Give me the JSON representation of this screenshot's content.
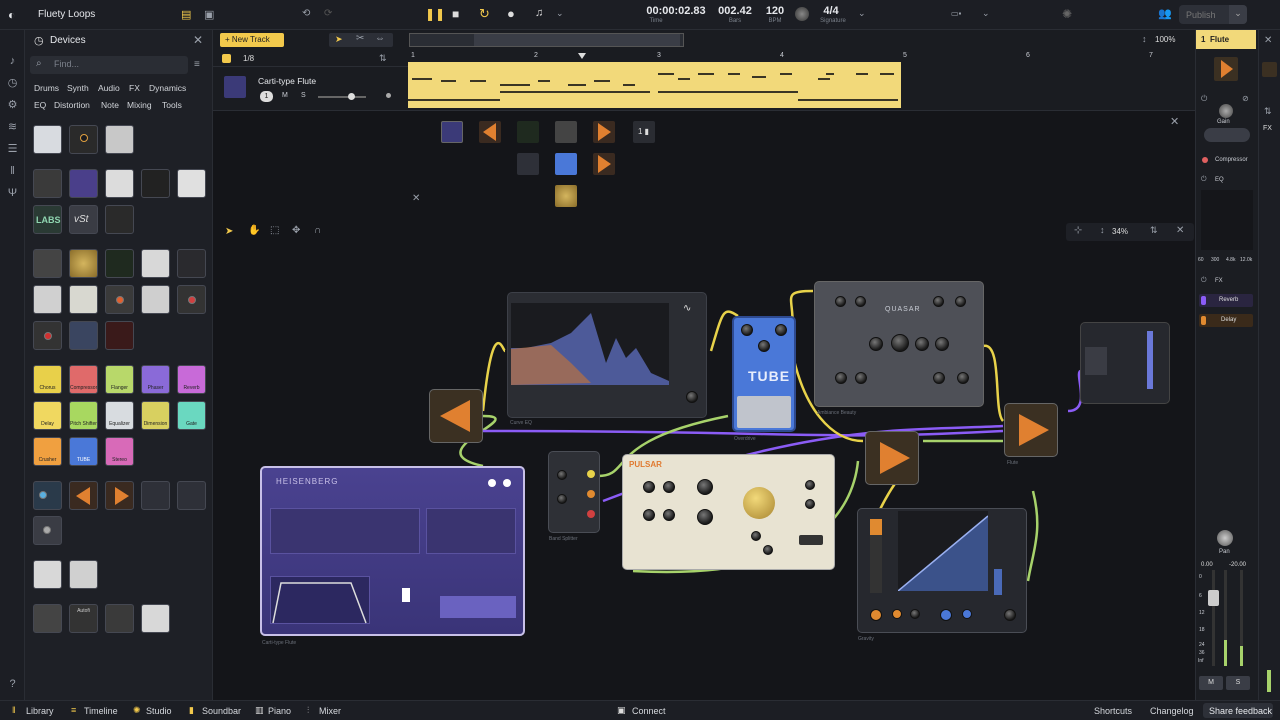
{
  "app": {
    "title": "Fluety Loops"
  },
  "transport": {
    "time": "00:00:02.83",
    "time_label": "Time",
    "bars": "002.42",
    "bars_label": "Bars",
    "bpm": "120",
    "bpm_label": "BPM",
    "signature": "4/4",
    "signature_label": "Signature"
  },
  "topbar": {
    "publish": "Publish"
  },
  "devices_panel": {
    "title": "Devices",
    "search_placeholder": "Find...",
    "categories_row1": [
      "Drums",
      "Synth",
      "Audio",
      "FX",
      "Dynamics"
    ],
    "categories_row2": [
      "EQ",
      "Distortion",
      "Note",
      "Mixing",
      "Tools"
    ],
    "tile_labels": {
      "labs": "LABS",
      "vst": "vSt",
      "tube": "TUBE",
      "chorus": "Chorus",
      "comp": "Compressor",
      "flanger": "Flanger",
      "phaser": "Phaser",
      "reverb": "Reverb",
      "delay": "Delay",
      "pitch": "Pitch Shifter",
      "eq": "Equalizer",
      "dim": "Dimension",
      "gate": "Gate",
      "crusher": "Crusher",
      "stereo": "Stereo",
      "autofi": "Autofi"
    }
  },
  "timeline": {
    "new_track": "New Track",
    "zoom": "100%",
    "quantize": "1/8",
    "ruler": [
      "1",
      "2",
      "3",
      "4",
      "5",
      "6",
      "7"
    ],
    "track": {
      "name": "Carti-type Flute",
      "number": "1",
      "mute": "M",
      "solo": "S"
    }
  },
  "studio": {
    "zoom": "34%",
    "devices": {
      "heisenberg": "HEISENBERG",
      "heisenberg_footer": "Carti-type Flute",
      "pulsar": "PULSAR",
      "tube": "TUBE",
      "quasar": "QUASAR",
      "quasar_footer": "Ambiance Beauty",
      "splitter": "Band Splitter",
      "gravity": "Gravity",
      "flute": "Flute",
      "overdrive": "Overdrive",
      "curve": "Curve EQ"
    }
  },
  "inspector": {
    "track_number": "1",
    "track_name": "Flute",
    "gain": "Gain",
    "compressor": "Compressor",
    "eq": "EQ",
    "eq_ticks": [
      "60",
      "300",
      "4.8k",
      "12.0k"
    ],
    "fx": "FX",
    "fx_items": [
      "Reverb",
      "Delay"
    ],
    "pan": "Pan",
    "levels": [
      "0.00",
      "-20.00"
    ],
    "meter_ticks": [
      "0",
      "6",
      "12",
      "18",
      "24",
      "36",
      "Inf"
    ],
    "mute": "M",
    "solo": "S"
  },
  "bottombar": {
    "library": "Library",
    "timeline": "Timeline",
    "studio": "Studio",
    "soundbar": "Soundbar",
    "piano": "Piano",
    "mixer": "Mixer",
    "connect": "Connect",
    "shortcuts": "Shortcuts",
    "changelog": "Changelog",
    "share": "Share feedback"
  },
  "colors": {
    "accent": "#f2c94c",
    "cable_purple": "#8b5cf6",
    "cable_yellow": "#e8d24a",
    "cable_green": "#a7d26b",
    "clip": "#f2d97a"
  }
}
